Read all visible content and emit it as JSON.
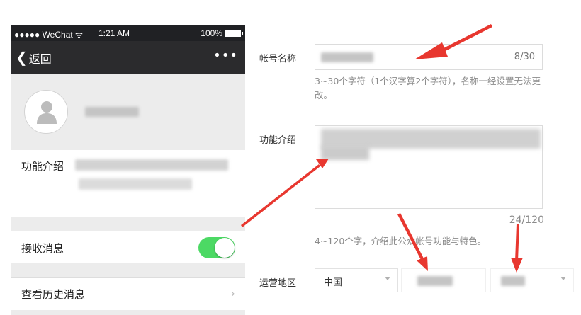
{
  "phone": {
    "status": {
      "carrier": "●●●●● WeChat ᯤ",
      "time": "1:21 AM",
      "battery": "100%"
    },
    "nav": {
      "back_chevron": "❮",
      "back_label": "返回",
      "more_label": "•••"
    },
    "intro_label": "功能介绍",
    "receive_label": "接收消息",
    "receive_enabled": true,
    "history_label": "查看历史消息",
    "history_chevron": "›"
  },
  "form": {
    "name": {
      "label": "帐号名称",
      "count": "8/30",
      "hint": "3~30个字符（1个汉字算2个字符），名称一经设置无法更改。"
    },
    "function": {
      "label": "功能介绍",
      "count": "24/120",
      "hint": "4~120个字，介绍此公众帐号功能与特色。"
    },
    "region": {
      "label": "运营地区",
      "country": "中国"
    }
  },
  "colors": {
    "toggle_on": "#4cd964",
    "annotation_arrow": "#e8372f",
    "nav_bg": "#2b2b2d"
  },
  "icons": [
    "person-placeholder-icon",
    "back-chevron-icon",
    "more-icon",
    "chevron-right-icon",
    "dropdown-arrow-icon",
    "battery-icon",
    "annotation-arrow"
  ]
}
